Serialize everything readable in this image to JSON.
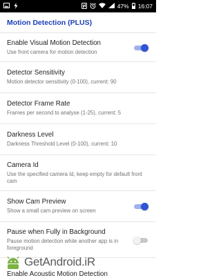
{
  "status_bar": {
    "left_icons": [
      "image-icon",
      "flash-icon"
    ],
    "right_icons": [
      "nfc-icon",
      "alarm-icon",
      "wifi-icon",
      "signal-icon"
    ],
    "battery": "47%",
    "time": "16:07"
  },
  "header": {
    "title": "Motion Detection (PLUS)"
  },
  "prefs": [
    {
      "title": "Enable Visual Motion Detection",
      "summary": "Use front camera for motion detection",
      "toggle": "on"
    },
    {
      "title": "Detector Sensitivity",
      "summary": "Motion detector sensitivity (0-100), current: 90"
    },
    {
      "title": "Detector Frame Rate",
      "summary": "Frames per second to analyse (1-25), current: 5"
    },
    {
      "title": "Darkness Level",
      "summary": "Darkness Threshold Level (0-100), current: 10"
    },
    {
      "title": "Camera Id",
      "summary": "Use the specified camera Id, keep empty for default front cam"
    },
    {
      "title": "Show Cam Preview",
      "summary": "Show a small cam preview on screen",
      "toggle": "on"
    },
    {
      "title": "Pause when Fully in Background",
      "summary": "Pause motion detection while another app is in foreground",
      "toggle": "off"
    }
  ],
  "cut_item": {
    "title": "Enable Acoustic Motion Detection"
  },
  "watermark": {
    "text": "GetAndroid.iR"
  },
  "colors": {
    "accent": "#2d55d6",
    "header": "#1a3fb8"
  }
}
